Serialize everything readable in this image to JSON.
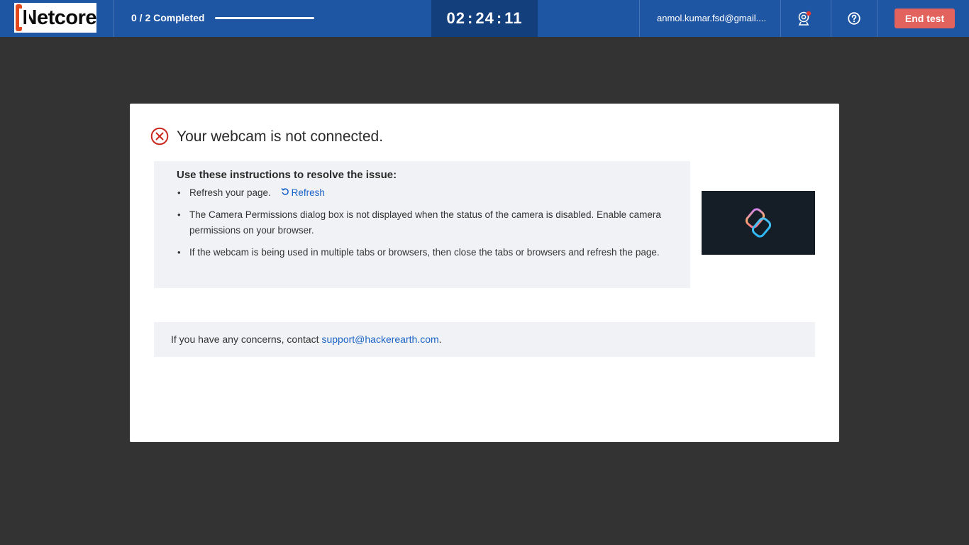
{
  "header": {
    "logo_text": "Netcore",
    "progress_label": "0 / 2 Completed",
    "progress_fraction": 0.0,
    "timer": {
      "hours": "02",
      "minutes": "24",
      "seconds": "11",
      "sep": ":"
    },
    "user_email": "anmol.kumar.fsd@gmail....",
    "webcam_icon": "webcam-icon",
    "help_icon": "help-circle-icon",
    "end_test_label": "End test",
    "colors": {
      "bar": "#1f56a4",
      "timer_bg": "#133f7d",
      "end_button": "#e2625d",
      "status_dot": "#e53935"
    }
  },
  "dialog": {
    "error_icon": "error-circle-icon",
    "title": "Your webcam is not connected.",
    "instructions_heading": "Use these instructions to resolve the issue:",
    "items": [
      {
        "text": "Refresh your page.",
        "link_label": "Refresh",
        "link_icon": "refresh-icon"
      },
      {
        "text": "The Camera Permissions dialog box is not displayed when the status of the camera is disabled. Enable camera permissions on your browser."
      },
      {
        "text": "If the webcam is being used in multiple tabs or browsers, then close the tabs or browsers and refresh the page."
      }
    ],
    "preview_icon": "chain-link-icon",
    "contact_prefix": "If you have any concerns, contact ",
    "contact_email": "support@hackerearth.com",
    "contact_suffix": ".",
    "colors": {
      "error_red": "#c9281e",
      "link_blue": "#1a63c6",
      "panel_bg": "#f1f2f5",
      "preview_bg": "#151e27"
    }
  }
}
